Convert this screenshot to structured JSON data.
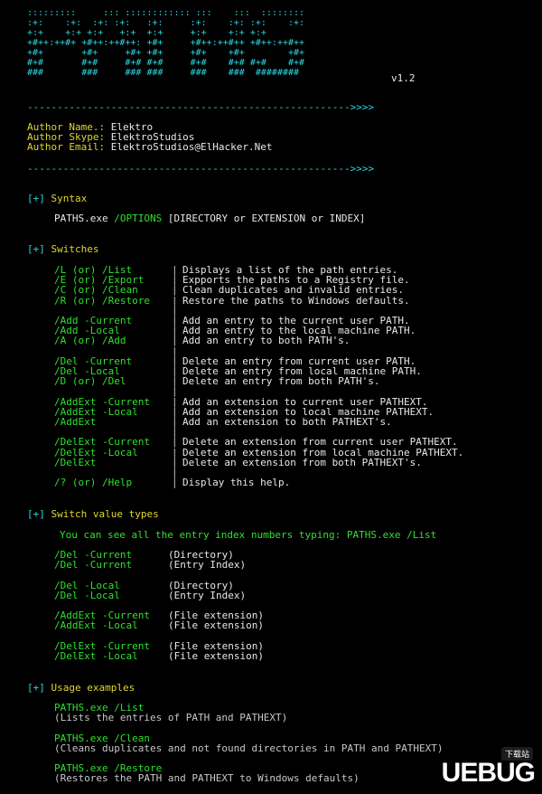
{
  "banner": {
    "art": [
      ":::::::::     ::: :::::::::::: :::    :::  ::::::::",
      ":+:    :+:  :+: :+:   :+:     :+:    :+: :+:    :+:",
      "+:+    +:+ +:+   +:+  +:+     +:+    +:+ +:+",
      "+#++:++#+ +#++:++#++: +#+     +#++:++#++ +#++:++#++",
      "+#+       +#+     +#+ +#+     +#+    +#+        +#+",
      "#+#       #+#     #+# #+#     #+#    #+# #+#    #+#",
      "###       ###     ### ###     ###    ###  ########"
    ],
    "version": "v1.2"
  },
  "divider": "------------------------------------------------------>>>>",
  "author": {
    "name_label": "Author Name.:",
    "name_value": " Elektro",
    "skype_label": "Author Skype:",
    "skype_value": " ElektroStudios",
    "email_label": "Author Email:",
    "email_value": " ElektroStudios@ElHacker.Net"
  },
  "syntax": {
    "heading_prefix": "[+]",
    "heading": " Syntax",
    "cmd": "PATHS.exe ",
    "options": "/OPTIONS",
    "args": " [DIRECTORY or EXTENSION or INDEX]"
  },
  "switches": {
    "heading_prefix": "[+]",
    "heading": " Switches",
    "rows": [
      {
        "sw": "/L (or) /List",
        "sep": "|",
        "desc": "Displays a list of the path entries."
      },
      {
        "sw": "/E (or) /Export",
        "sep": "|",
        "desc": "Expports the paths to a Registry file."
      },
      {
        "sw": "/C (or) /Clean",
        "sep": "|",
        "desc": "Clean duplicates and invalid entries."
      },
      {
        "sw": "/R (or) /Restore",
        "sep": "|",
        "desc": "Restore the paths to Windows defaults."
      },
      {
        "sw": "",
        "sep": "|",
        "desc": ""
      },
      {
        "sw": "/Add -Current",
        "sep": "|",
        "desc": "Add an entry to the current user PATH."
      },
      {
        "sw": "/Add -Local",
        "sep": "|",
        "desc": "Add an entry to the local machine PATH."
      },
      {
        "sw": "/A (or) /Add",
        "sep": "|",
        "desc": "Add an entry to both PATH's."
      },
      {
        "sw": "",
        "sep": "|",
        "desc": ""
      },
      {
        "sw": "/Del -Current",
        "sep": "|",
        "desc": "Delete an entry from current user PATH."
      },
      {
        "sw": "/Del -Local",
        "sep": "|",
        "desc": "Delete an entry from local machine PATH."
      },
      {
        "sw": "/D (or) /Del",
        "sep": "|",
        "desc": "Delete an entry from both PATH's."
      },
      {
        "sw": "",
        "sep": "|",
        "desc": ""
      },
      {
        "sw": "/AddExt -Current",
        "sep": "|",
        "desc": "Add an extension to current user PATHEXT."
      },
      {
        "sw": "/AddExt -Local",
        "sep": "|",
        "desc": "Add an extension to local machine PATHEXT."
      },
      {
        "sw": "/AddExt",
        "sep": "|",
        "desc": "Add an extension to both PATHEXT's."
      },
      {
        "sw": "",
        "sep": "|",
        "desc": ""
      },
      {
        "sw": "/DelExt -Current",
        "sep": "|",
        "desc": "Delete an extension from current user PATHEXT."
      },
      {
        "sw": "/DelExt -Local",
        "sep": "|",
        "desc": "Delete an extension from local machine PATHEXT."
      },
      {
        "sw": "/DelExt",
        "sep": "|",
        "desc": "Delete an extension from both PATHEXT's."
      },
      {
        "sw": "",
        "sep": "|",
        "desc": ""
      },
      {
        "sw": "/? (or) /Help",
        "sep": "|",
        "desc": "Display this help."
      }
    ]
  },
  "value_types": {
    "heading_prefix": "[+]",
    "heading": " Switch value types",
    "note": "You can see all the entry index numbers typing: PATHS.exe /List",
    "rows": [
      {
        "sw": "/Del -Current",
        "val": "(Directory)"
      },
      {
        "sw": "/Del -Current",
        "val": "(Entry Index)"
      },
      {
        "sw": "",
        "val": ""
      },
      {
        "sw": "/Del -Local",
        "val": "(Directory)"
      },
      {
        "sw": "/Del -Local",
        "val": "(Entry Index)"
      },
      {
        "sw": "",
        "val": ""
      },
      {
        "sw": "/AddExt -Current",
        "val": "(File extension)"
      },
      {
        "sw": "/AddExt -Local",
        "val": "(File extension)"
      },
      {
        "sw": "",
        "val": ""
      },
      {
        "sw": "/DelExt -Current",
        "val": "(File extension)"
      },
      {
        "sw": "/DelExt -Local",
        "val": "(File extension)"
      }
    ]
  },
  "usage": {
    "heading_prefix": "[+]",
    "heading": " Usage examples",
    "examples": [
      {
        "cmd": "PATHS.exe /List",
        "desc": "(Lists the entries of PATH and PATHEXT)"
      },
      {
        "cmd": "PATHS.exe /Clean",
        "desc": "(Cleans duplicates and not found directories in PATH and PATHEXT)"
      },
      {
        "cmd": "PATHS.exe /Restore",
        "desc": "(Restores the PATH and PATHEXT to Windows defaults)"
      }
    ]
  },
  "watermark": {
    "logo": "UEBUG",
    "badge": "下载站"
  },
  "colors": {
    "background": "#000000",
    "cyan": "#2bd6e0",
    "green": "#2fe02f",
    "yellow": "#e0d62f",
    "gray": "#c8c8c8"
  }
}
